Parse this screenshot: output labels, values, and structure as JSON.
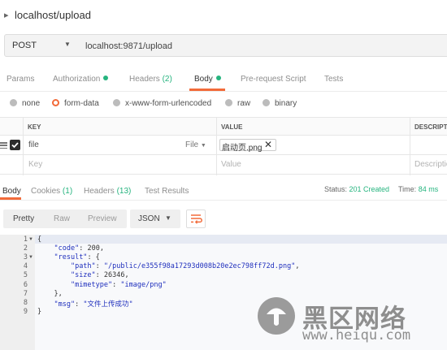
{
  "request": {
    "title": "localhost/upload",
    "method": "POST",
    "url": "localhost:9871/upload"
  },
  "tabs": [
    {
      "label": "Params"
    },
    {
      "label": "Authorization",
      "dot": true
    },
    {
      "label": "Headers",
      "count": "(2)"
    },
    {
      "label": "Body",
      "dot": true,
      "active": true
    },
    {
      "label": "Pre-request Script"
    },
    {
      "label": "Tests"
    }
  ],
  "body_types": {
    "none": "none",
    "form_data": "form-data",
    "urlencoded": "x-www-form-urlencoded",
    "raw": "raw",
    "binary": "binary",
    "selected": "form-data"
  },
  "kv_table": {
    "headers": {
      "key": "KEY",
      "value": "VALUE",
      "description": "DESCRIPTION"
    },
    "rows": [
      {
        "key": "file",
        "type": "File",
        "value": "启动页.png",
        "checked": true
      }
    ],
    "placeholders": {
      "key": "Key",
      "value": "Value",
      "description": "Description"
    }
  },
  "response": {
    "tabs": {
      "body": "Body",
      "cookies": "Cookies",
      "cookies_count": "(1)",
      "headers": "Headers",
      "headers_count": "(13)",
      "tests": "Test Results"
    },
    "status_label": "Status:",
    "status": "201 Created",
    "time_label": "Time:",
    "time": "84 ms",
    "views": {
      "pretty": "Pretty",
      "raw": "Raw",
      "preview": "Preview"
    },
    "format": "JSON",
    "code_lines": [
      {
        "n": "1",
        "fold": true,
        "parts": [
          [
            "p",
            "{"
          ]
        ]
      },
      {
        "n": "2",
        "parts": [
          [
            "p",
            "    "
          ],
          [
            "s",
            "\"code\""
          ],
          [
            "p",
            ": "
          ],
          [
            "n",
            "200"
          ],
          [
            "p",
            ","
          ]
        ]
      },
      {
        "n": "3",
        "fold": true,
        "parts": [
          [
            "p",
            "    "
          ],
          [
            "s",
            "\"result\""
          ],
          [
            "p",
            ": {"
          ]
        ]
      },
      {
        "n": "4",
        "parts": [
          [
            "p",
            "        "
          ],
          [
            "s",
            "\"path\""
          ],
          [
            "p",
            ": "
          ],
          [
            "s",
            "\"/public/e355f98a17293d008b20e2ec798ff72d.png\""
          ],
          [
            "p",
            ","
          ]
        ]
      },
      {
        "n": "5",
        "parts": [
          [
            "p",
            "        "
          ],
          [
            "s",
            "\"size\""
          ],
          [
            "p",
            ": "
          ],
          [
            "n",
            "26346"
          ],
          [
            "p",
            ","
          ]
        ]
      },
      {
        "n": "6",
        "parts": [
          [
            "p",
            "        "
          ],
          [
            "s",
            "\"mimetype\""
          ],
          [
            "p",
            ": "
          ],
          [
            "s",
            "\"image/png\""
          ]
        ]
      },
      {
        "n": "7",
        "parts": [
          [
            "p",
            "    },"
          ]
        ]
      },
      {
        "n": "8",
        "parts": [
          [
            "p",
            "    "
          ],
          [
            "s",
            "\"msg\""
          ],
          [
            "p",
            ": "
          ],
          [
            "s",
            "\"文件上传成功\""
          ]
        ]
      },
      {
        "n": "9",
        "parts": [
          [
            "p",
            "}"
          ]
        ]
      }
    ]
  },
  "watermark": {
    "title": "黑区网络",
    "url": "www.heiqu.com"
  },
  "colors": {
    "accent": "#f26b3a",
    "success": "#26b47f",
    "string": "#1f2fbd"
  },
  "icons": {
    "collapse": "chevron-down-icon",
    "wrap": "wrap-lines-icon",
    "remove": "close-icon"
  }
}
